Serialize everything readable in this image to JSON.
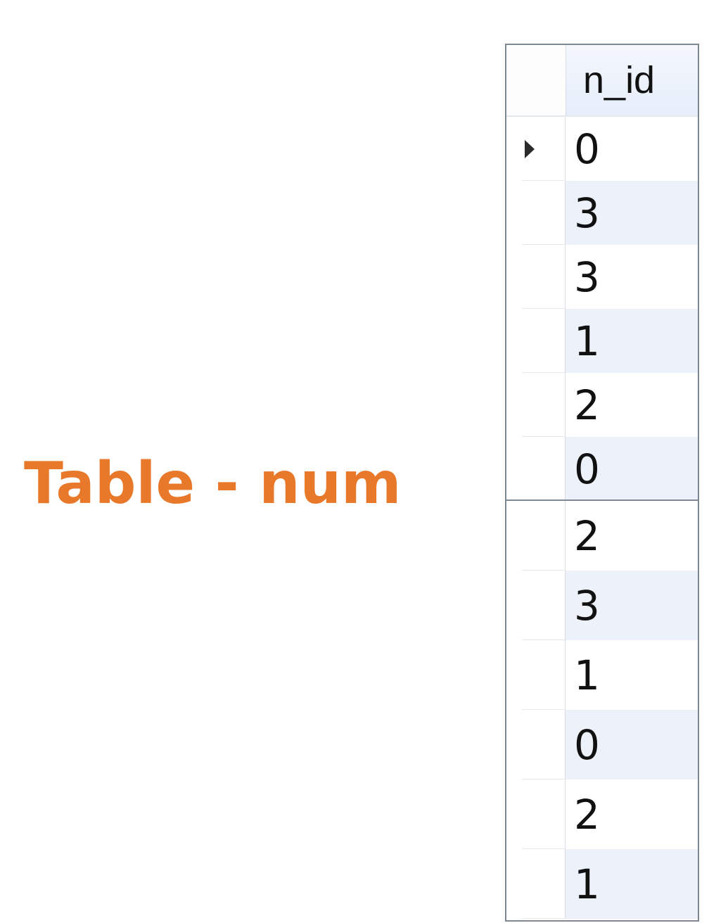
{
  "caption": "Table - num",
  "table": {
    "column_header": "n_id",
    "top_rows": [
      "0",
      "3",
      "3",
      "1",
      "2",
      "0"
    ],
    "bottom_rows": [
      "2",
      "3",
      "1",
      "0",
      "2",
      "1"
    ]
  },
  "colors": {
    "caption": "#e8782a",
    "alt_row": "#edf1fa",
    "border": "#7f8790"
  },
  "icons": {
    "current_row": "row-indicator-arrow-icon"
  }
}
